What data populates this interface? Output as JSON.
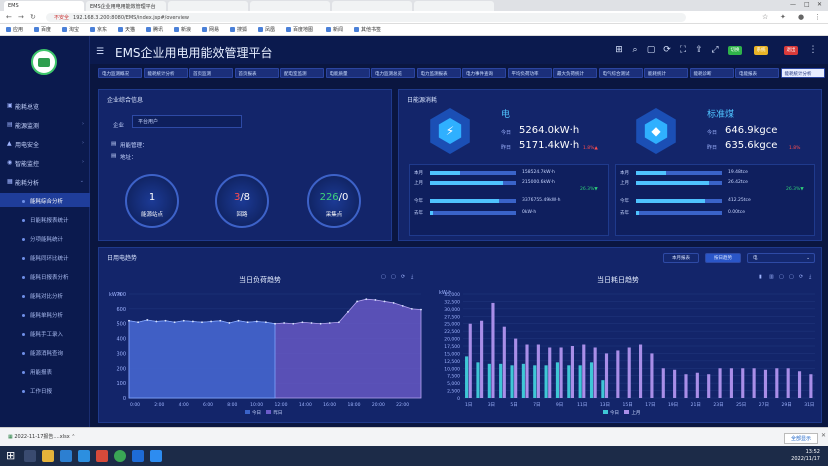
{
  "browser": {
    "tabs": [
      "EMS",
      "EMS企业用电用能效管理平台",
      "",
      "",
      "",
      ""
    ],
    "url": "192.168.3.200:8080/EMS/index.jsp#/overview",
    "security": "不安全",
    "bookmarks": [
      "应用",
      "百度",
      "淘宝",
      "京东",
      "天猫",
      "腾讯",
      "新浪",
      "网易",
      "搜狐",
      "凤凰",
      "百度地图",
      "新闻",
      "其他书签"
    ],
    "download": {
      "file": "2022-11-17报告....xlsx",
      "show_all": "全部显示"
    },
    "clock": {
      "time": "13:52",
      "date": "2022/11/17"
    }
  },
  "app": {
    "title": "EMS企业用电用能效管理平台",
    "header_buttons": [
      {
        "label": "切换",
        "color": "#2fb34a"
      },
      {
        "label": "系统",
        "color": "#e8b326"
      },
      {
        "label": "退出",
        "color": "#d93a3a"
      }
    ],
    "nav_tabs": [
      "电力监测概况",
      "能耗统计分析",
      "首页监测",
      "首页报表",
      "配电室监测",
      "电能质量",
      "电力监测总览",
      "电力监测报表",
      "电力事件查询",
      "平均负荷功率",
      "最大负荷统计",
      "电气综合测试",
      "能耗统计",
      "能耗诊断",
      "电能报表",
      "能耗统计分析"
    ],
    "sidebar": {
      "items": [
        {
          "label": "能耗总览",
          "icon": "▣",
          "type": "top"
        },
        {
          "label": "能源监测",
          "icon": "▤",
          "type": "top",
          "arrow": "›"
        },
        {
          "label": "用电安全",
          "icon": "▲",
          "type": "top",
          "arrow": "›"
        },
        {
          "label": "智能监控",
          "icon": "◉",
          "type": "top",
          "arrow": "›"
        },
        {
          "label": "能耗分析",
          "icon": "▦",
          "type": "top",
          "arrow": "⌄"
        },
        {
          "label": "能耗综合分析",
          "type": "sub",
          "active": true
        },
        {
          "label": "日能耗报表统计",
          "type": "sub"
        },
        {
          "label": "分项能耗统计",
          "type": "sub"
        },
        {
          "label": "能耗同环比统计",
          "type": "sub"
        },
        {
          "label": "能耗日报表分析",
          "type": "sub"
        },
        {
          "label": "能耗对比分析",
          "type": "sub"
        },
        {
          "label": "能耗单耗分析",
          "type": "sub"
        },
        {
          "label": "能耗手工录入",
          "type": "sub"
        },
        {
          "label": "能源消耗查询",
          "type": "sub"
        },
        {
          "label": "用能报表",
          "type": "sub"
        },
        {
          "label": "工作日报",
          "type": "sub"
        }
      ]
    },
    "overview": {
      "title": "企业综合信息",
      "company_label": "企业",
      "company_value": "平台用户",
      "lines": [
        "用能管理：",
        "地址："
      ],
      "dials": [
        {
          "value": "1",
          "label": "能源站点",
          "color": "#ffffff"
        },
        {
          "value": "3",
          "value_suffix": "/8",
          "label": "回路",
          "color": "#ff4d4d"
        },
        {
          "value": "226",
          "value_suffix": "/0",
          "label": "采集点",
          "color": "#3fd27a"
        }
      ]
    },
    "energy": {
      "title": "日能源消耗",
      "cards": [
        {
          "name": "电",
          "icon": "⚡",
          "today_label": "今日",
          "today": "5264.0kW·h",
          "yest_label": "昨日",
          "yest": "5171.4kW·h",
          "pct": "1.8%▲",
          "pct_color": "#ff4d4d",
          "rows": [
            {
              "label": "本月",
              "fill": 0.35,
              "value": "158524.7kW·h"
            },
            {
              "label": "上月",
              "fill": 0.85,
              "value": "215000.6kW·h"
            },
            {
              "label": "今年",
              "fill": 0.8,
              "value": "3376755.49kW·h"
            },
            {
              "label": "去年",
              "fill": 0.03,
              "value": "0kW·h"
            }
          ],
          "pct2": "26.3%▼",
          "pct2_color": "#2ecf7a"
        },
        {
          "name": "标准煤",
          "icon": "◆",
          "today_label": "今日",
          "today": "646.9kgce",
          "yest_label": "昨日",
          "yest": "635.6kgce",
          "pct": "1.8%",
          "pct_color": "#ff4d4d",
          "rows": [
            {
              "label": "本月",
              "fill": 0.35,
              "value": "19.48tce"
            },
            {
              "label": "上月",
              "fill": 0.85,
              "value": "26.42tce"
            },
            {
              "label": "今年",
              "fill": 0.8,
              "value": "412.25tce"
            },
            {
              "label": "去年",
              "fill": 0.03,
              "value": "0.00tce"
            }
          ],
          "pct2": "26.3%▼",
          "pct2_color": "#2ecf7a"
        }
      ]
    },
    "trend": {
      "title": "日用电趋势",
      "btn_month": "本月报表",
      "btn_day": "按日趋势",
      "select_value": "电",
      "left_chart_title": "当日负荷趋势",
      "right_chart_title": "当日耗日趋势",
      "left_legend": [
        "今日",
        "昨日"
      ],
      "right_legend": [
        "今日",
        "上月"
      ]
    }
  },
  "chart_data": [
    {
      "type": "area",
      "title": "当日负荷趋势",
      "ylabel": "kW·h",
      "ylim": [
        0,
        700
      ],
      "yticks": [
        0,
        100,
        200,
        300,
        400,
        500,
        600,
        700
      ],
      "x": [
        "0:00",
        "2:00",
        "4:00",
        "6:00",
        "8:00",
        "10:00",
        "12:00",
        "14:00",
        "16:00",
        "18:00",
        "20:00",
        "22:00"
      ],
      "series": [
        {
          "name": "今日",
          "color": "#3a63c9",
          "values": [
            520,
            510,
            525,
            515,
            520,
            510,
            520,
            515,
            510,
            515,
            520,
            505,
            520,
            510,
            515,
            510,
            500
          ]
        },
        {
          "name": "昨日",
          "color": "#6b5bc9",
          "values": [
            520,
            510,
            525,
            515,
            520,
            510,
            520,
            515,
            510,
            515,
            520,
            505,
            520,
            510,
            515,
            510,
            500,
            505,
            500,
            510,
            505,
            500,
            505,
            510,
            580,
            650,
            665,
            660,
            650,
            640,
            620,
            600,
            595
          ]
        }
      ]
    },
    {
      "type": "bar",
      "title": "当日耗日趋势",
      "ylabel": "kW·h",
      "ylim": [
        0,
        35000
      ],
      "yticks": [
        0,
        2500,
        5000,
        7500,
        10000,
        12500,
        15000,
        17500,
        20000,
        22500,
        25000,
        27500,
        30000,
        32500,
        35000
      ],
      "categories": [
        "1日",
        "2日",
        "3日",
        "4日",
        "5日",
        "6日",
        "7日",
        "8日",
        "9日",
        "10日",
        "11日",
        "12日",
        "13日",
        "14日",
        "15日",
        "16日",
        "17日",
        "18日",
        "19日",
        "20日",
        "21日",
        "22日",
        "23日",
        "24日",
        "25日",
        "26日",
        "27日",
        "28日",
        "29日",
        "30日",
        "31日"
      ],
      "series": [
        {
          "name": "今日",
          "color": "#3fc7d6",
          "values": [
            14000,
            12000,
            11500,
            11500,
            11000,
            11500,
            11000,
            11000,
            12000,
            11000,
            11000,
            12000,
            6000,
            0,
            0,
            0,
            0,
            0,
            0,
            0,
            0,
            0,
            0,
            0,
            0,
            0,
            0,
            0,
            0,
            0,
            0
          ]
        },
        {
          "name": "上月",
          "color": "#a98ee8",
          "values": [
            25000,
            26000,
            32000,
            24000,
            20000,
            18000,
            18000,
            17000,
            17000,
            17500,
            18000,
            17000,
            15000,
            16000,
            17000,
            18000,
            15000,
            10000,
            9500,
            8000,
            8500,
            8000,
            10000,
            10000,
            10000,
            10000,
            9500,
            10000,
            10000,
            9000,
            8000
          ]
        }
      ]
    }
  ]
}
